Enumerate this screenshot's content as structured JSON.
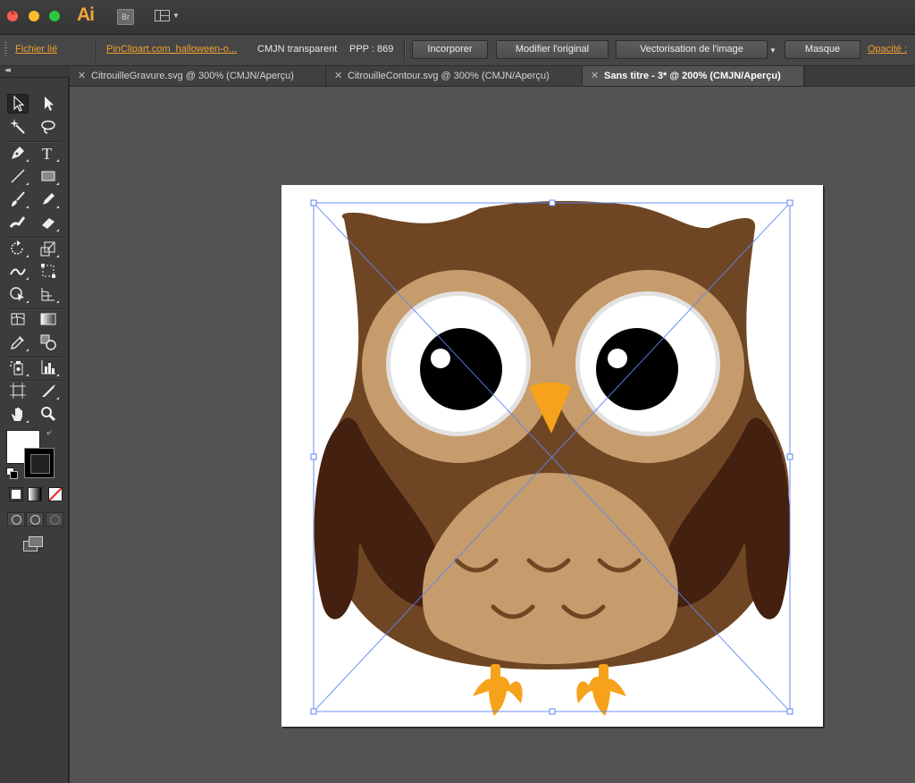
{
  "app": {
    "name": "Ai",
    "bridge_label": "Br"
  },
  "control_bar": {
    "linked_file_label": "Fichier lié",
    "filename": "PinClipart.com_halloween-o...",
    "color_mode": "CMJN transparent",
    "ppi": "PPP : 869",
    "embed_button": "Incorporer",
    "edit_original_button": "Modifier l'original",
    "image_trace_button": "Vectorisation de l'image",
    "mask_button": "Masque",
    "opacity_label": "Opacité :"
  },
  "tabs": [
    {
      "label": "CitrouilleGravure.svg @ 300% (CMJN/Aperçu)",
      "active": false
    },
    {
      "label": "CitrouilleContour.svg @ 300% (CMJN/Aperçu)",
      "active": false
    },
    {
      "label": "Sans titre - 3* @ 200% (CMJN/Aperçu)",
      "active": true
    }
  ],
  "tools": [
    "selection-tool",
    "direct-selection-tool",
    "magic-wand-tool",
    "lasso-tool",
    "pen-tool",
    "type-tool",
    "line-segment-tool",
    "rectangle-tool",
    "paintbrush-tool",
    "pencil-tool",
    "blob-brush-tool",
    "eraser-tool",
    "rotate-tool",
    "scale-tool",
    "width-tool",
    "free-transform-tool",
    "shape-builder-tool",
    "perspective-grid-tool",
    "mesh-tool",
    "gradient-tool",
    "eyedropper-tool",
    "blend-tool",
    "symbol-sprayer-tool",
    "column-graph-tool",
    "artboard-tool",
    "slice-tool",
    "hand-tool",
    "zoom-tool"
  ],
  "colors": {
    "owl_body": "#6f4623",
    "owl_wing": "#432010",
    "owl_face": "#c69c6d",
    "owl_eye_white": "#ffffff",
    "owl_pupil": "#000000",
    "owl_beak": "#f7a21b",
    "selection": "#5b86f0",
    "accent": "#f0a030"
  }
}
